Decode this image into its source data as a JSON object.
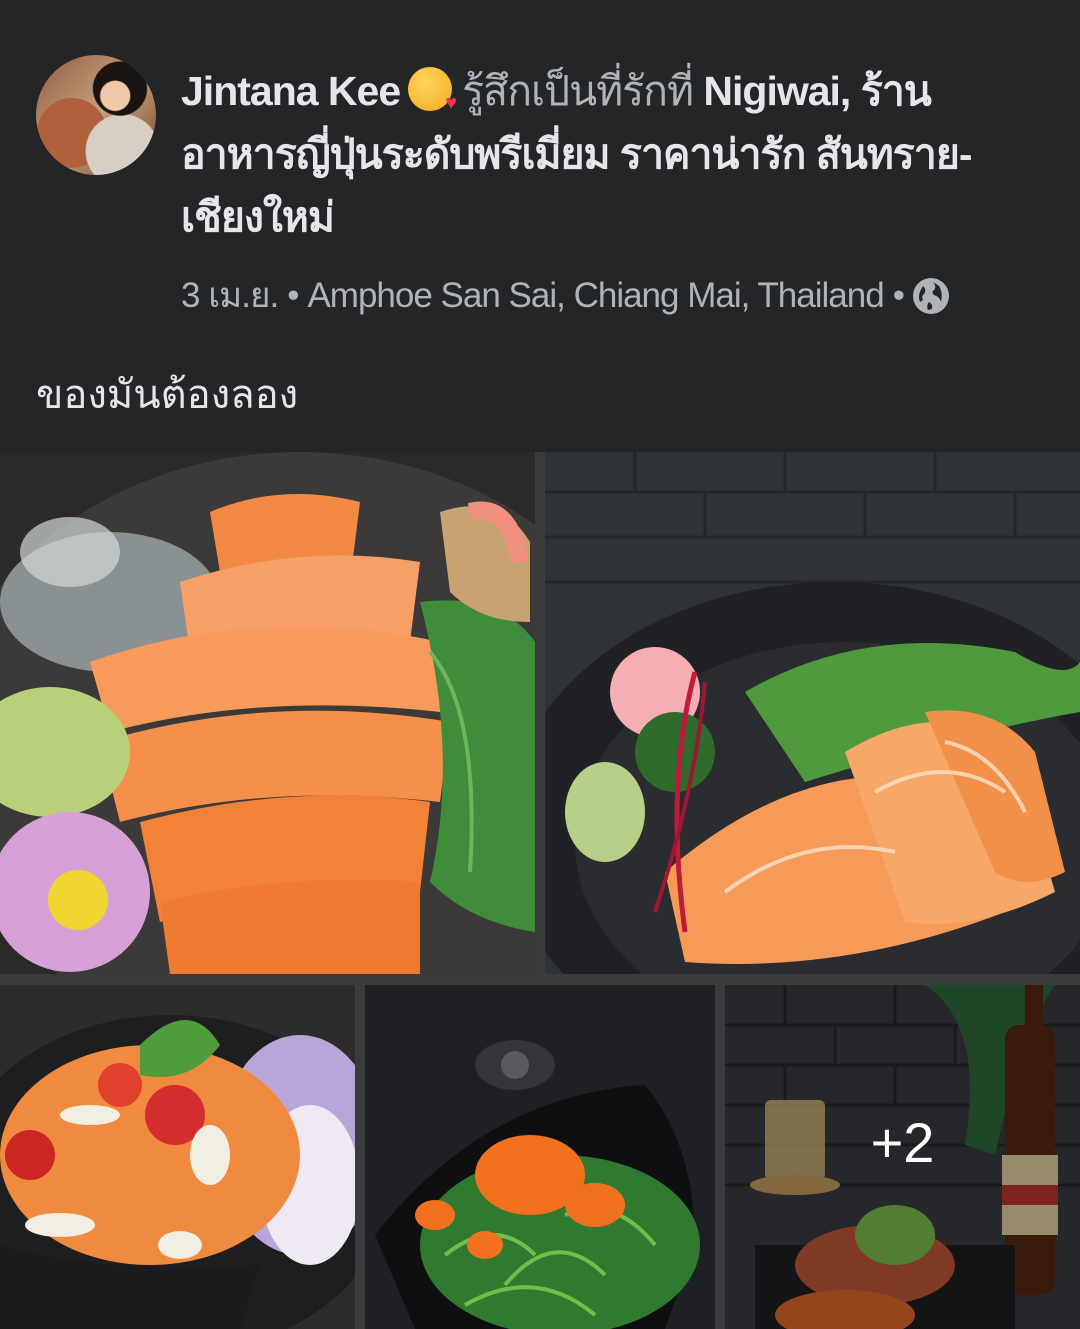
{
  "post": {
    "author": "Jintana Kee",
    "feeling": "รู้สึกเป็นที่รักที่",
    "place": "Nigiwai, ร้านอาหารญี่ปุ่นระดับพรีเมี่ยม ราคาน่ารัก สันทราย-เชียงใหม่",
    "date": "3 เม.ย.",
    "separator": "•",
    "location": "Amphoe San Sai, Chiang Mai, Thailand",
    "privacy_icon": "globe-icon",
    "emoji_icon": "smiling-face-with-hearts-icon",
    "text": "ของมันต้องลอง"
  },
  "photos": {
    "more_count": "+2",
    "items": [
      {
        "desc_icon": "salmon-sashimi-photo"
      },
      {
        "desc_icon": "salmon-don-photo"
      },
      {
        "desc_icon": "salmon-salad-photo"
      },
      {
        "desc_icon": "seaweed-salad-photo"
      },
      {
        "desc_icon": "beer-table-photo"
      }
    ]
  },
  "colors": {
    "background": "#242526",
    "primary_text": "#e4e6eb",
    "secondary_text": "#b0b3b8"
  }
}
